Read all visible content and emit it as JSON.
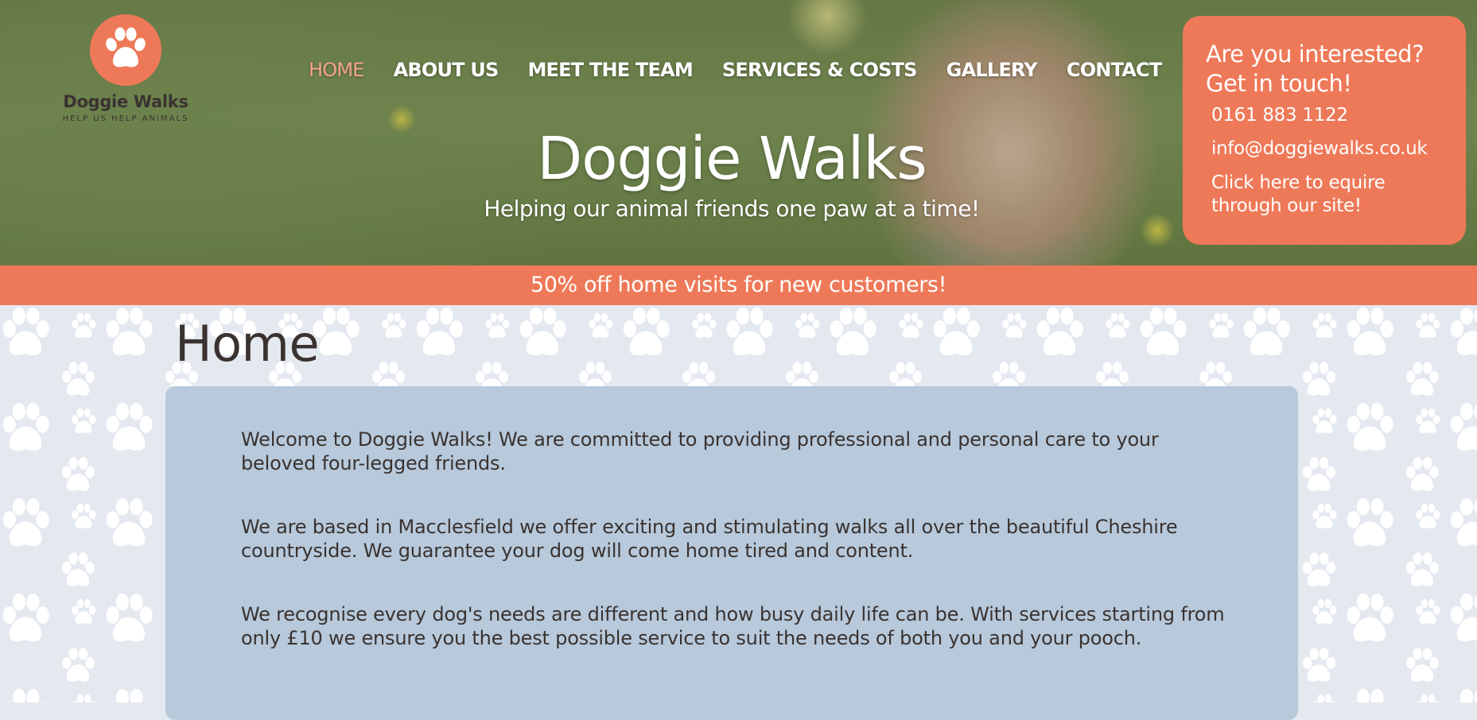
{
  "brand": {
    "name": "Doggie Walks",
    "tagline": "HELP US HELP ANIMALS",
    "accent_color": "#ee7958",
    "logo_icon": "paw-icon"
  },
  "nav": {
    "items": [
      {
        "label": "HOME",
        "active": true
      },
      {
        "label": "ABOUT US",
        "active": false
      },
      {
        "label": "MEET THE TEAM",
        "active": false
      },
      {
        "label": "SERVICES & COSTS",
        "active": false
      },
      {
        "label": "GALLERY",
        "active": false
      },
      {
        "label": "CONTACT",
        "active": false
      }
    ]
  },
  "hero": {
    "title": "Doggie Walks",
    "subtitle": "Helping our animal friends one paw at a time!"
  },
  "contact": {
    "heading_line1": "Are you interested?",
    "heading_line2": "Get in touch!",
    "phone": "0161 883 1122",
    "email": "info@doggiewalks.co.uk",
    "enquiry_link": "Click here to equire through our site!"
  },
  "promo": {
    "text": "50% off home visits for new customers!"
  },
  "main": {
    "page_title": "Home",
    "paragraphs": [
      "Welcome to Doggie Walks! We are committed to providing professional and personal care to your beloved four-legged friends.",
      "We are based in Macclesfield we offer exciting and stimulating walks all over the beautiful Cheshire countryside. We guarantee your dog will come home tired and content.",
      "We recognise every dog's needs are different and how busy daily life can be. With services starting from only £10 we ensure you the best possible service to suit the needs of both you and your pooch."
    ]
  }
}
